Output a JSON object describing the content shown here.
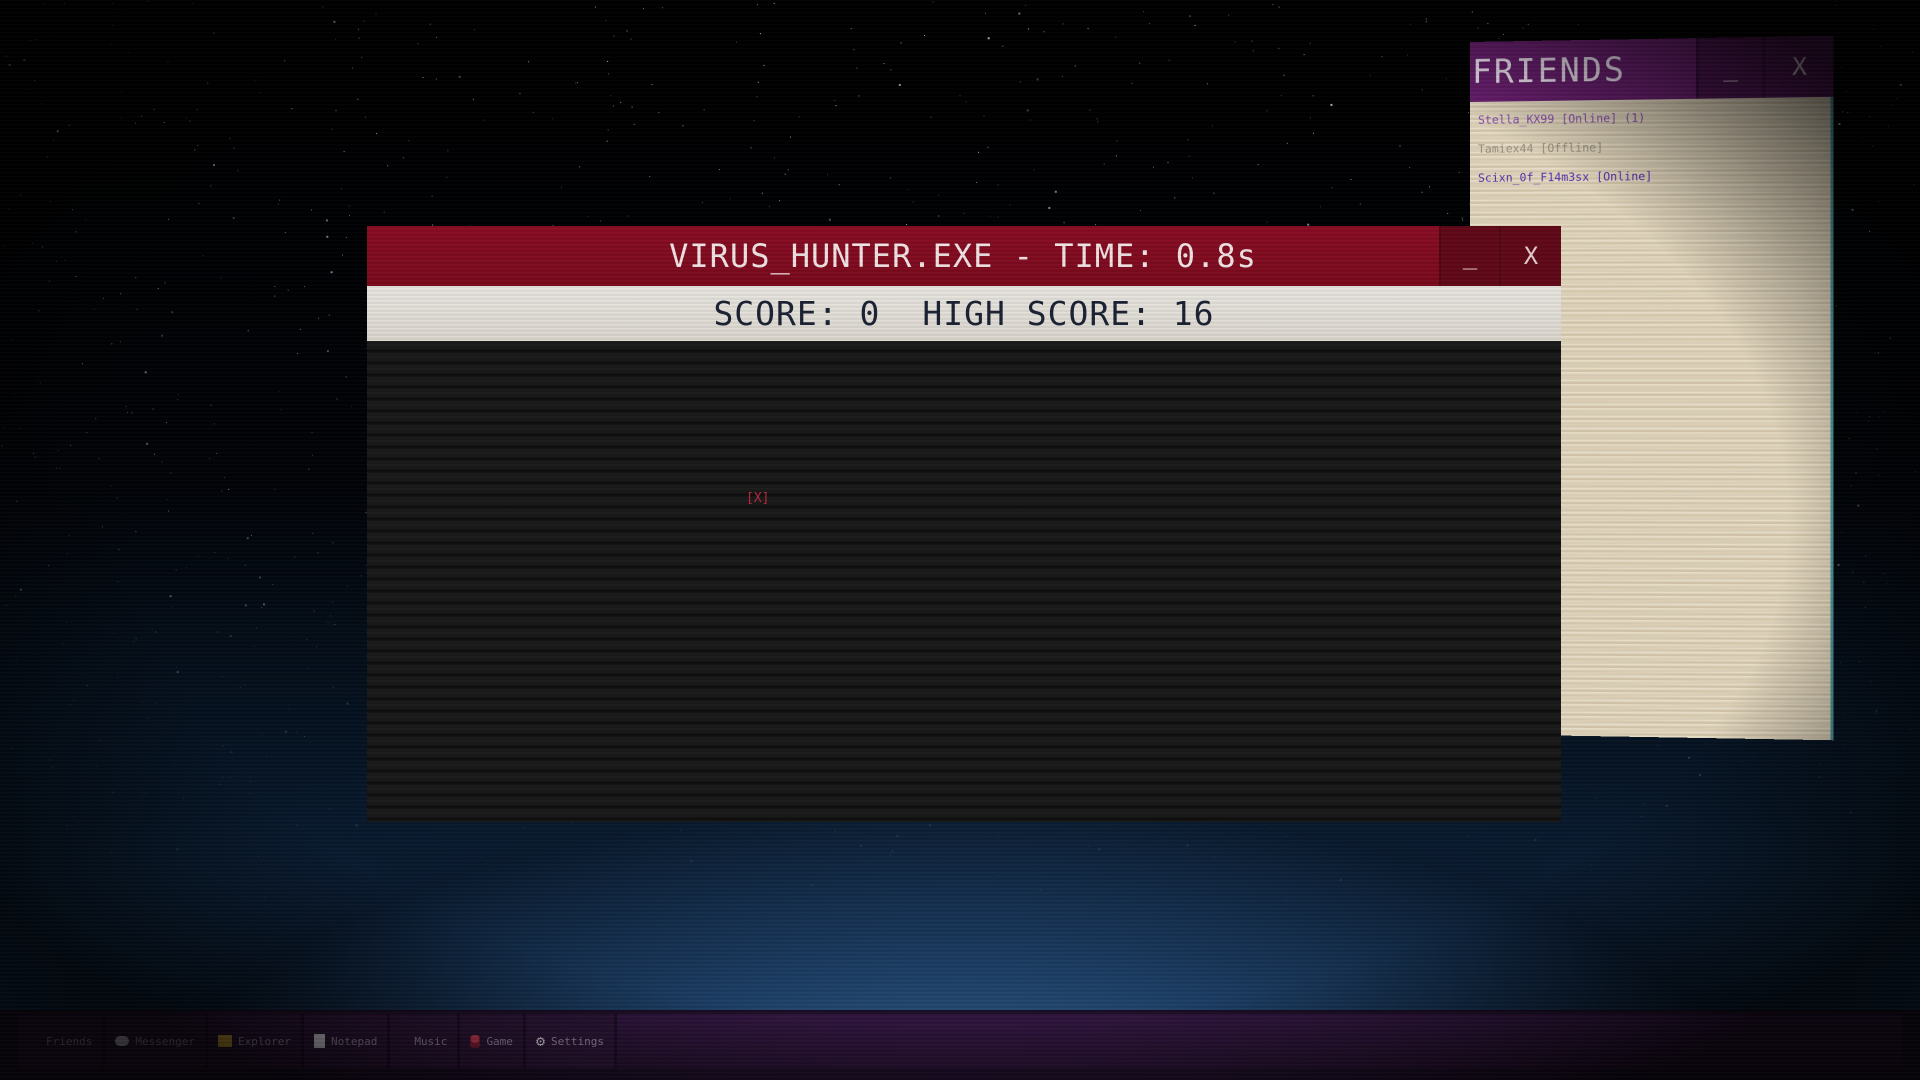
{
  "friends_window": {
    "title": "FRIENDS",
    "minimize_label": "_",
    "close_label": "X",
    "friends": [
      {
        "label": "Stella_KX99 [Online] (1)",
        "color": "#8a4fb6"
      },
      {
        "label": "Tamiex44 [Offline]",
        "color": "#9a9283"
      },
      {
        "label": "Scixn_0f_F14m3sx [Online]",
        "color": "#5a2fb0"
      }
    ]
  },
  "game_window": {
    "title": "VIRUS_HUNTER.EXE - TIME: 0.8s",
    "minimize_label": "_",
    "close_label": "X",
    "score_text": "SCORE: 0",
    "high_score_text": "HIGH SCORE: 16",
    "target_label": "[X]"
  },
  "taskbar": {
    "items": [
      {
        "label": "Friends",
        "icon": "none"
      },
      {
        "label": "Messenger",
        "icon": "speech-bubble-icon"
      },
      {
        "label": "Explorer",
        "icon": "folder-icon"
      },
      {
        "label": "Notepad",
        "icon": "notepad-icon"
      },
      {
        "label": "Music",
        "icon": "none"
      },
      {
        "label": "Game",
        "icon": "game-icon"
      },
      {
        "label": "Settings",
        "icon": "gear-icon"
      }
    ]
  },
  "colors": {
    "game_titlebar": "#7a0a1d",
    "friends_titlebar": "#5a1660",
    "taskbar": "#2b1536"
  }
}
